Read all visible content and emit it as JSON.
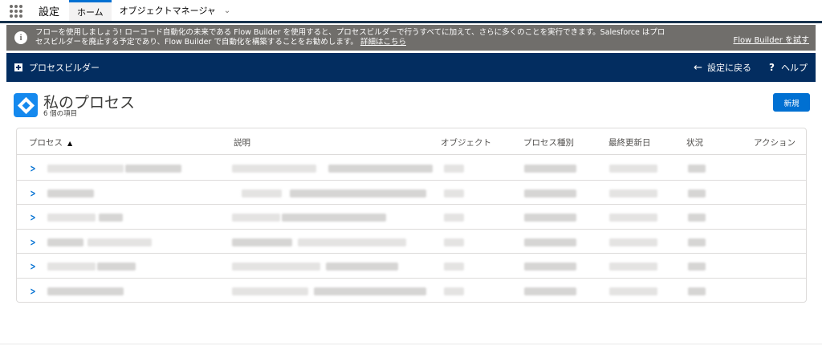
{
  "app": {
    "name": "設定",
    "tabs": [
      {
        "label": "ホーム",
        "active": true
      },
      {
        "label": "オブジェクトマネージャ",
        "active": false
      }
    ]
  },
  "banner": {
    "line1": "フローを使用しましょう! ローコード自動化の未来である Flow Builder を使用すると、プロセスビルダーで行うすべてに加えて、さらに多くのことを実行できます。Salesforce はプロ",
    "line2": "セスビルダーを廃止する予定であり、Flow Builder で自動化を構築することをお勧めします。",
    "details_link": "詳細はこちら",
    "try_link": "Flow Builder を試す"
  },
  "pb_header": {
    "title": "プロセスビルダー",
    "back_label": "設定に戻る",
    "help_label": "ヘルプ"
  },
  "page": {
    "title": "私のプロセス",
    "subtitle": "6 個の項目",
    "new_button": "新規"
  },
  "table": {
    "columns": [
      "プロセス",
      "説明",
      "オブジェクト",
      "プロセス種別",
      "最終更新日",
      "状況",
      "アクション"
    ],
    "sorted_column": "プロセス",
    "sort_direction": "ascending",
    "row_count": 6
  },
  "colors": {
    "nav_dark": "#032d60",
    "banner_gray": "#706e6b",
    "brand_blue": "#0070d2",
    "icon_blue": "#1589ee"
  }
}
